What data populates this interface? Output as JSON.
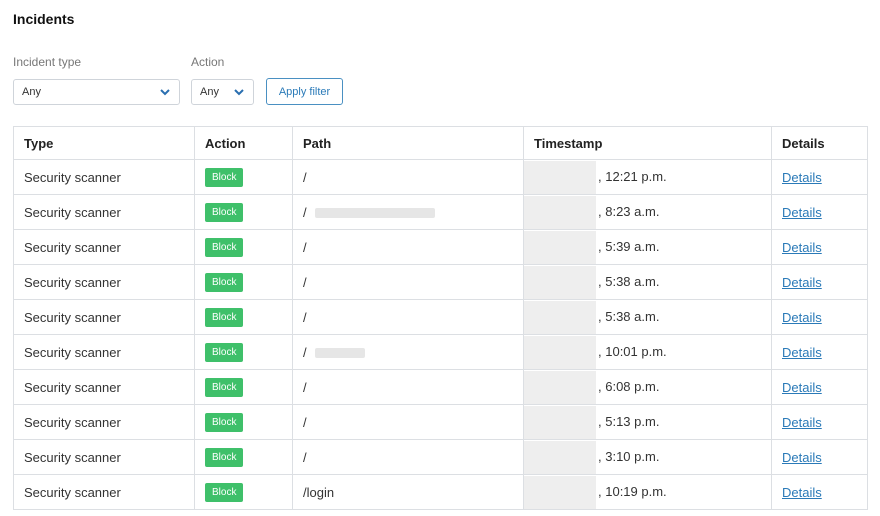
{
  "page": {
    "title": "Incidents"
  },
  "filters": {
    "incident_type": {
      "label": "Incident type",
      "value": "Any"
    },
    "action": {
      "label": "Action",
      "value": "Any"
    },
    "apply_label": "Apply filter"
  },
  "table": {
    "columns": [
      "Type",
      "Action",
      "Path",
      "Timestamp",
      "Details"
    ],
    "rows": [
      {
        "type": "Security scanner",
        "action": "Block",
        "path": "/",
        "path_redacted": false,
        "timestamp": "12:21 p.m.",
        "details": "Details"
      },
      {
        "type": "Security scanner",
        "action": "Block",
        "path": "/",
        "path_redacted": true,
        "timestamp": "8:23 a.m.",
        "details": "Details"
      },
      {
        "type": "Security scanner",
        "action": "Block",
        "path": "/",
        "path_redacted": false,
        "timestamp": "5:39 a.m.",
        "details": "Details"
      },
      {
        "type": "Security scanner",
        "action": "Block",
        "path": "/",
        "path_redacted": false,
        "timestamp": "5:38 a.m.",
        "details": "Details"
      },
      {
        "type": "Security scanner",
        "action": "Block",
        "path": "/",
        "path_redacted": false,
        "timestamp": "5:38 a.m.",
        "details": "Details"
      },
      {
        "type": "Security scanner",
        "action": "Block",
        "path": "/",
        "path_redacted": true,
        "timestamp": "10:01 p.m.",
        "details": "Details"
      },
      {
        "type": "Security scanner",
        "action": "Block",
        "path": "/",
        "path_redacted": false,
        "timestamp": "6:08 p.m.",
        "details": "Details"
      },
      {
        "type": "Security scanner",
        "action": "Block",
        "path": "/",
        "path_redacted": false,
        "timestamp": "5:13 p.m.",
        "details": "Details"
      },
      {
        "type": "Security scanner",
        "action": "Block",
        "path": "/",
        "path_redacted": false,
        "timestamp": "3:10 p.m.",
        "details": "Details"
      },
      {
        "type": "Security scanner",
        "action": "Block",
        "path": "/login",
        "path_redacted": false,
        "timestamp": "10:19 p.m.",
        "details": "Details"
      }
    ]
  },
  "colors": {
    "badge": "#3fc06a",
    "link": "#2a7ab8",
    "border": "#dcdfe3"
  }
}
